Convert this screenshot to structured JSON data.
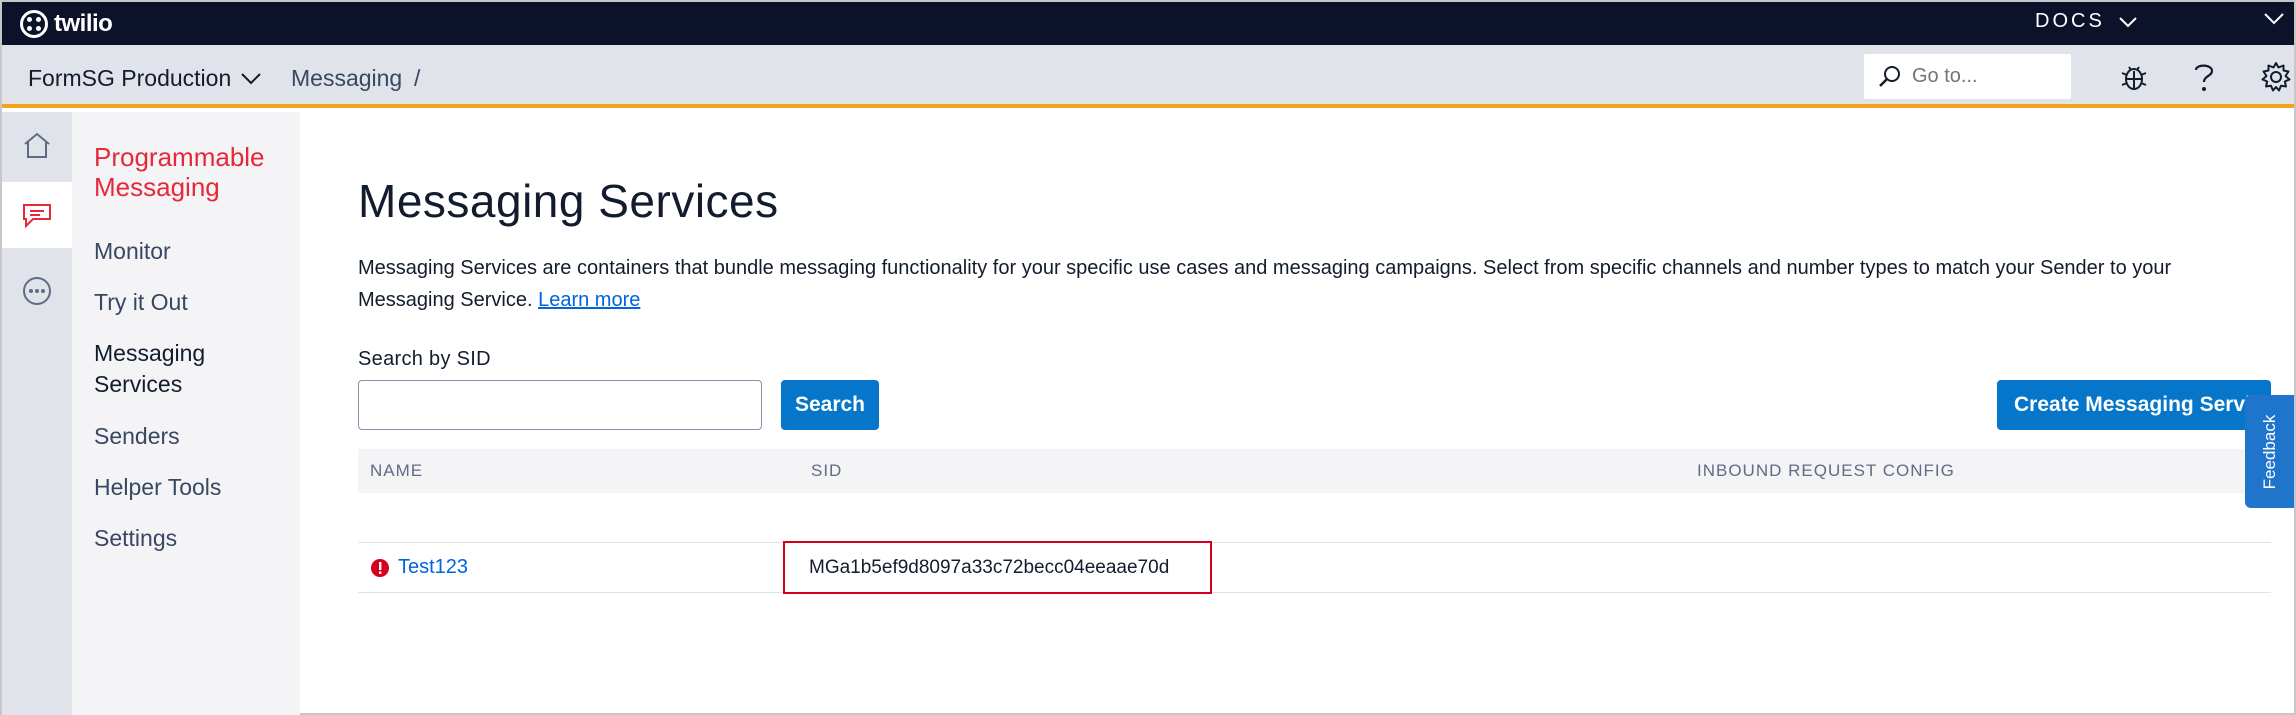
{
  "topbar": {
    "brand": "twilio",
    "docs_label": "DOCS"
  },
  "subbar": {
    "project": "FormSG Production",
    "breadcrumb": "Messaging",
    "breadcrumb_sep": "/",
    "goto_placeholder": "Go to..."
  },
  "rail": {
    "items": [
      "home-icon",
      "messaging-icon",
      "more-icon"
    ],
    "active": "messaging-icon"
  },
  "sidebar": {
    "title": "Programmable Messaging",
    "items": [
      {
        "label": "Monitor"
      },
      {
        "label": "Try it Out"
      },
      {
        "label": "Messaging Services"
      },
      {
        "label": "Senders"
      },
      {
        "label": "Helper Tools"
      },
      {
        "label": "Settings"
      }
    ],
    "active": "Messaging Services"
  },
  "main": {
    "title": "Messaging Services",
    "description": "Messaging Services are containers that bundle messaging functionality for your specific use cases and messaging campaigns. Select from specific channels and number types to match your Sender to your Messaging Service.",
    "learn_more": "Learn more",
    "search_label": "Search by SID",
    "search_value": "",
    "search_button": "Search",
    "create_button": "Create Messaging Service",
    "table": {
      "columns": [
        "NAME",
        "SID",
        "INBOUND REQUEST CONFIG"
      ],
      "rows": [
        {
          "name": "Test123",
          "sid": "MGa1b5ef9d8097a33c72becc04eeaae70d",
          "inbound": ""
        }
      ]
    }
  },
  "feedback_label": "Feedback",
  "colors": {
    "brand_red": "#e5293b",
    "primary_blue": "#0576c9",
    "topbar": "#0d122b",
    "accent_orange": "#f4a21c",
    "highlight_red": "#d6001c"
  }
}
